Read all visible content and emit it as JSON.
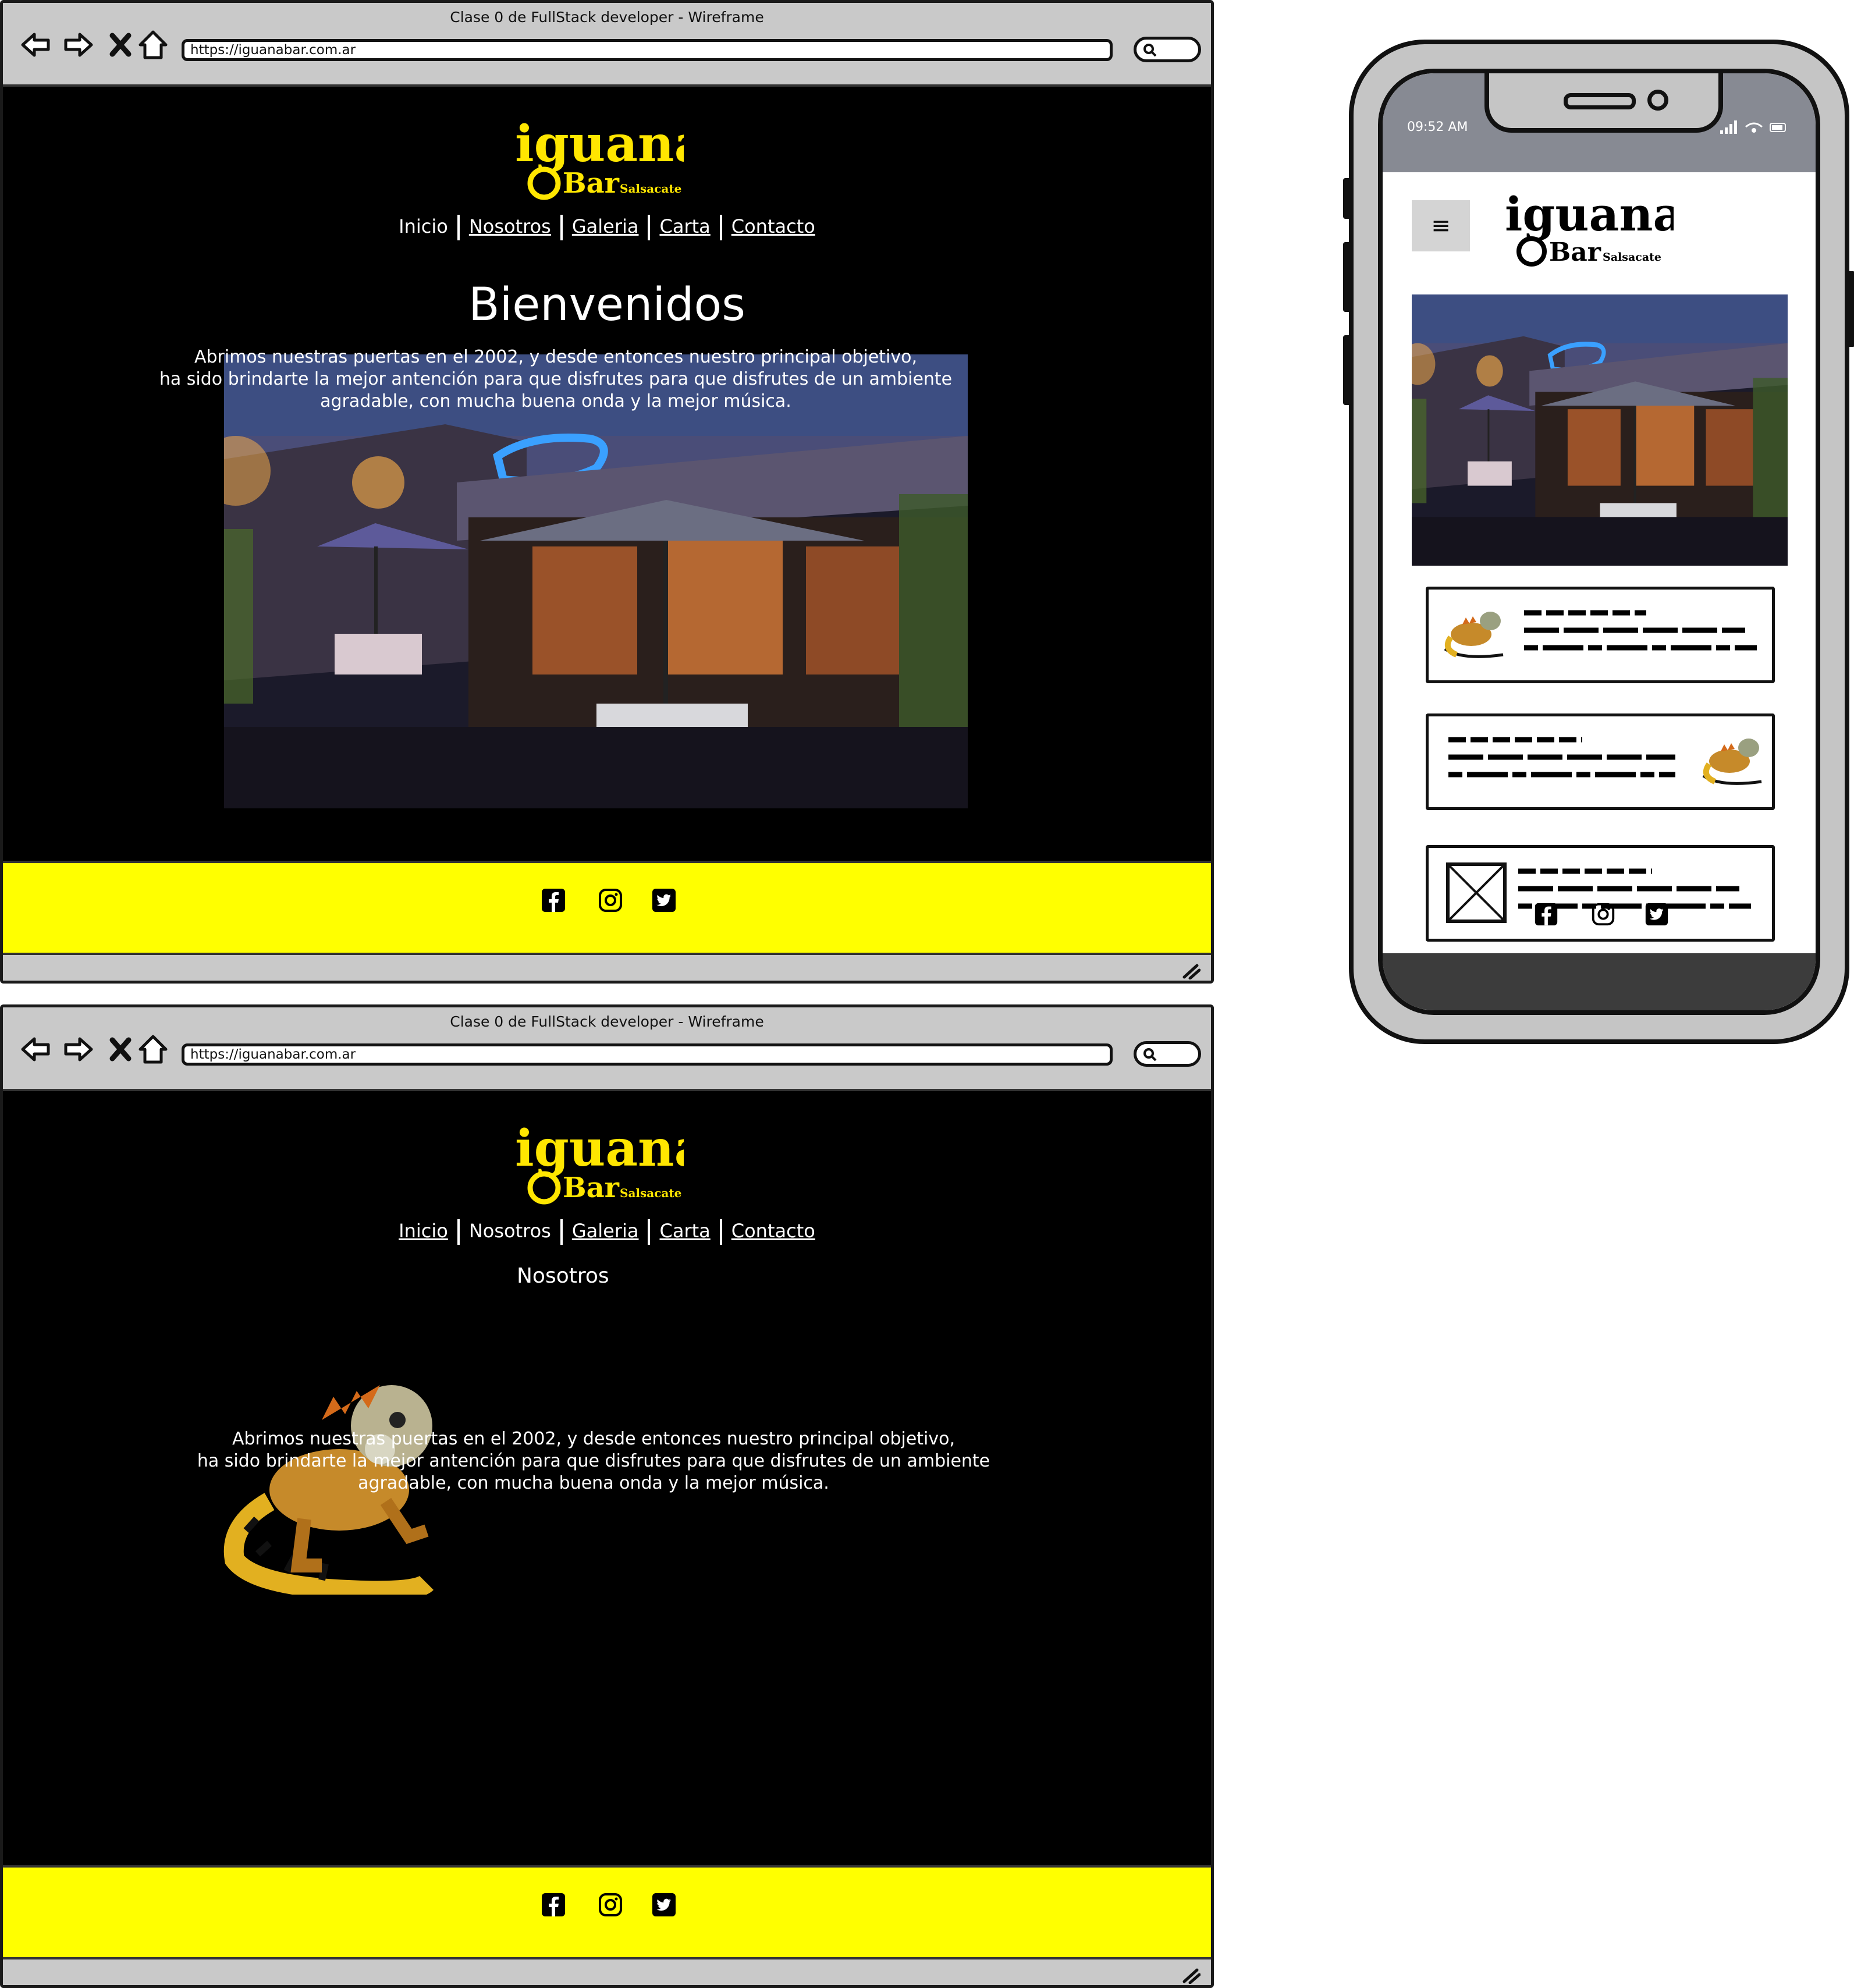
{
  "window": {
    "title": "Clase 0 de FullStack developer - Wireframe",
    "url": "https://iguanabar.com.ar"
  },
  "logo": {
    "word1": "iguana",
    "word2": "Bar",
    "tagline": "Salsacate"
  },
  "nav_items": [
    "Inicio",
    "Nosotros",
    "Galeria",
    "Carta",
    "Contacto"
  ],
  "home": {
    "heading": "Bienvenidos",
    "intro": "Abrimos nuestras puertas en el 2002, y desde entonces nuestro principal objetivo,\nha sido brindarte la mejor antención para que disfrutes para que disfrutes de un ambiente\nagradable, con mucha buena onda y la mejor música.",
    "active_nav": "Inicio"
  },
  "about": {
    "heading": "Nosotros",
    "intro": "Abrimos nuestras puertas en el 2002, y desde entonces nuestro principal objetivo,\nha sido brindarte la mejor antención para que disfrutes para que disfrutes de un ambiente\nagradable, con mucha buena onda y la mejor música.",
    "active_nav": "Nosotros"
  },
  "social_icons": [
    "facebook-icon",
    "instagram-icon",
    "twitter-icon"
  ],
  "phone": {
    "time": "09:52 AM",
    "menu_glyph": "≡"
  },
  "colors": {
    "accent_yellow": "#ffff00",
    "page_bg": "#000000",
    "chrome_gray": "#c9c9c9"
  }
}
